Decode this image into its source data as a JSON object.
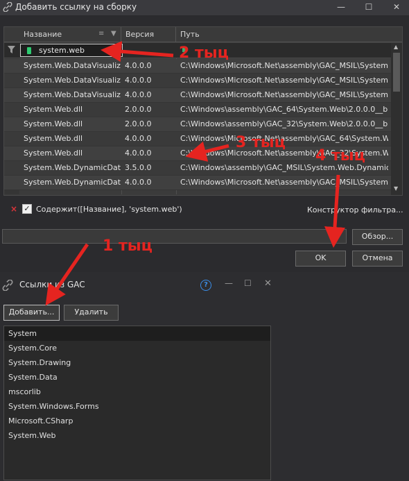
{
  "dialog": {
    "title": "Добавить ссылку на сборку",
    "columns": {
      "name": "Название",
      "version": "Версия",
      "path": "Путь"
    },
    "filter_value": "system.web",
    "rows": [
      {
        "name": "System.Web.DataVisualiz...",
        "version": "4.0.0.0",
        "path": "C:\\Windows\\Microsoft.Net\\assembly\\GAC_MSIL\\System.W..."
      },
      {
        "name": "System.Web.DataVisualiz...",
        "version": "4.0.0.0",
        "path": "C:\\Windows\\Microsoft.Net\\assembly\\GAC_MSIL\\System.W..."
      },
      {
        "name": "System.Web.DataVisualiz...",
        "version": "4.0.0.0",
        "path": "C:\\Windows\\Microsoft.Net\\assembly\\GAC_MSIL\\System.W..."
      },
      {
        "name": "System.Web.dll",
        "version": "2.0.0.0",
        "path": "C:\\Windows\\assembly\\GAC_64\\System.Web\\2.0.0.0__b0..."
      },
      {
        "name": "System.Web.dll",
        "version": "2.0.0.0",
        "path": "C:\\Windows\\assembly\\GAC_32\\System.Web\\2.0.0.0__b0..."
      },
      {
        "name": "System.Web.dll",
        "version": "4.0.0.0",
        "path": "C:\\Windows\\Microsoft.Net\\assembly\\GAC_64\\System.Web..."
      },
      {
        "name": "System.Web.dll",
        "version": "4.0.0.0",
        "path": "C:\\Windows\\Microsoft.Net\\assembly\\GAC_32\\System.Web..."
      },
      {
        "name": "System.Web.DynamicDat...",
        "version": "3.5.0.0",
        "path": "C:\\Windows\\assembly\\GAC_MSIL\\System.Web.DynamicDat..."
      },
      {
        "name": "System.Web.DynamicDat...",
        "version": "4.0.0.0",
        "path": "C:\\Windows\\Microsoft.Net\\assembly\\GAC_MSIL\\System.W..."
      }
    ],
    "filter_expression": "Содержит([Название], 'system.web')",
    "filter_builder": "Конструктор фильтра...",
    "browse_label": "Обзор...",
    "ok_label": "OK",
    "cancel_label": "Отмена"
  },
  "gac_panel": {
    "title": "Ссылки из GAC",
    "add_label": "Добавить...",
    "remove_label": "Удалить",
    "items": [
      "System",
      "System.Core",
      "System.Drawing",
      "System.Data",
      "mscorlib",
      "System.Windows.Forms",
      "Microsoft.CSharp",
      "System.Web"
    ]
  },
  "annotations": {
    "step1": "1 тыц",
    "step2": "2 тыц",
    "step3": "3 тыц",
    "step4": "4 тыц",
    "color": "#e52420"
  }
}
